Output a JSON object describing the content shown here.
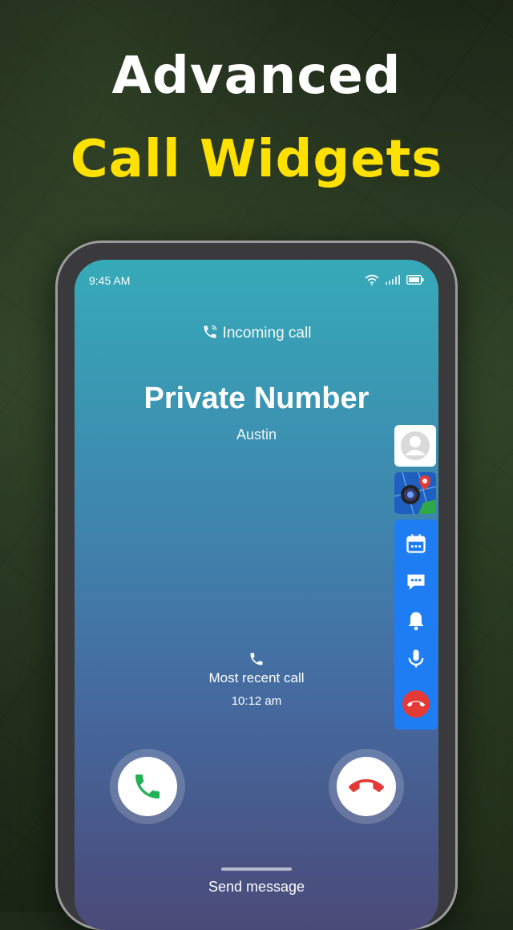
{
  "headline": {
    "line1": "Advanced",
    "line2": "Call Widgets"
  },
  "status_bar": {
    "time": "9:45 AM",
    "icons": [
      "wifi-icon",
      "signal-icon",
      "battery-icon"
    ]
  },
  "call": {
    "incoming_label": "Incoming call",
    "caller_name": "Private Number",
    "caller_sub": "Austin",
    "recent_label": "Most recent call",
    "recent_time": "10:12 am",
    "send_message": "Send message"
  },
  "widgets": [
    "contact-icon",
    "map-camera-icon",
    "calendar-icon",
    "message-icon",
    "bell-icon",
    "mic-icon",
    "end-call-icon"
  ],
  "colors": {
    "headline_accent": "#ffe100",
    "accept": "#20b255",
    "decline": "#e53935",
    "widget_bar": "#1f7df4"
  }
}
